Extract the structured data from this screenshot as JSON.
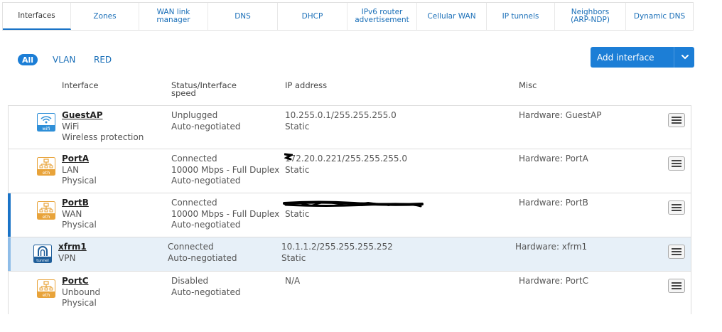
{
  "tabs": [
    {
      "label": "Interfaces",
      "active": true
    },
    {
      "label": "Zones"
    },
    {
      "label": "WAN link manager"
    },
    {
      "label": "DNS"
    },
    {
      "label": "DHCP"
    },
    {
      "label": "IPv6 router advertisement"
    },
    {
      "label": "Cellular WAN"
    },
    {
      "label": "IP tunnels"
    },
    {
      "label": "Neighbors (ARP-NDP)"
    },
    {
      "label": "Dynamic DNS"
    }
  ],
  "filters": {
    "all": "All",
    "vlan": "VLAN",
    "red": "RED"
  },
  "add_button": {
    "label": "Add interface"
  },
  "columns": {
    "interface": "Interface",
    "status": "Status/Interface speed",
    "ip": "IP address",
    "misc": "Misc"
  },
  "rows": [
    {
      "name": "GuestAP",
      "type": "WiFi",
      "sub": "Wireless protection",
      "icon_label": "wifi",
      "status": [
        "Unplugged",
        "Auto-negotiated",
        ""
      ],
      "ip": "10.255.0.1/255.255.255.0",
      "ip_mode": "Static",
      "misc": "Hardware:  GuestAP"
    },
    {
      "name": "PortA",
      "type": "LAN",
      "sub": "Physical",
      "icon_label": "eth",
      "status": [
        "Connected",
        "10000 Mbps - Full Duplex",
        "Auto-negotiated"
      ],
      "ip": "172.20.0.221/255.255.255.0",
      "ip_mode": "Static",
      "misc": "Hardware:  PortA"
    },
    {
      "name": "PortB",
      "type": "WAN",
      "sub": "Physical",
      "icon_label": "eth",
      "status": [
        "Connected",
        "10000 Mbps - Full Duplex",
        "Auto-negotiated"
      ],
      "ip": "",
      "ip_mode": "Static",
      "misc": "Hardware:  PortB"
    },
    {
      "name": "xfrm1",
      "type": "VPN",
      "sub": "",
      "icon_label": "tunnel",
      "status": [
        "Connected",
        "Auto-negotiated",
        ""
      ],
      "ip": "10.1.1.2/255.255.255.252",
      "ip_mode": "Static",
      "misc": "Hardware:  xfrm1"
    },
    {
      "name": "PortC",
      "type": "Unbound",
      "sub": "Physical",
      "icon_label": "eth",
      "status": [
        "Disabled",
        "Auto-negotiated",
        ""
      ],
      "ip": "N/A",
      "ip_mode": "",
      "misc": "Hardware:  PortC"
    }
  ],
  "colors": {
    "accent": "#1c7ed6",
    "eth_icon": "#e8a33a",
    "wifi_icon": "#2e8fd8",
    "tunnel_icon": "#1f5e9a"
  }
}
